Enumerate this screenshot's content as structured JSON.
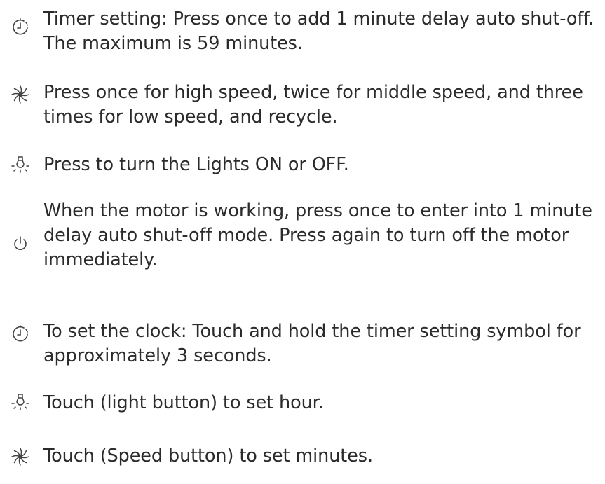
{
  "instructions": {
    "items": [
      {
        "icon": "timer-icon",
        "text": "Timer setting: Press once to add 1 minute delay auto shut-off. The maximum is 59 minutes."
      },
      {
        "icon": "fan-speed-icon",
        "text": "Press once for high speed, twice for middle speed, and three times for low speed, and recycle."
      },
      {
        "icon": "light-bulb-icon",
        "text": "Press to turn the Lights ON or OFF."
      },
      {
        "icon": "power-icon",
        "text": "When the motor is working, press once to enter into 1 minute delay auto shut-off mode. Press again to turn off the motor immediately."
      }
    ]
  },
  "clock_setting": {
    "items": [
      {
        "icon": "timer-icon",
        "text": "To set the clock: Touch and hold the timer setting symbol for approximately 3 seconds."
      },
      {
        "icon": "light-bulb-icon",
        "text": "Touch (light button) to set hour."
      },
      {
        "icon": "fan-speed-icon",
        "text": "Touch (Speed button) to set minutes."
      }
    ]
  }
}
